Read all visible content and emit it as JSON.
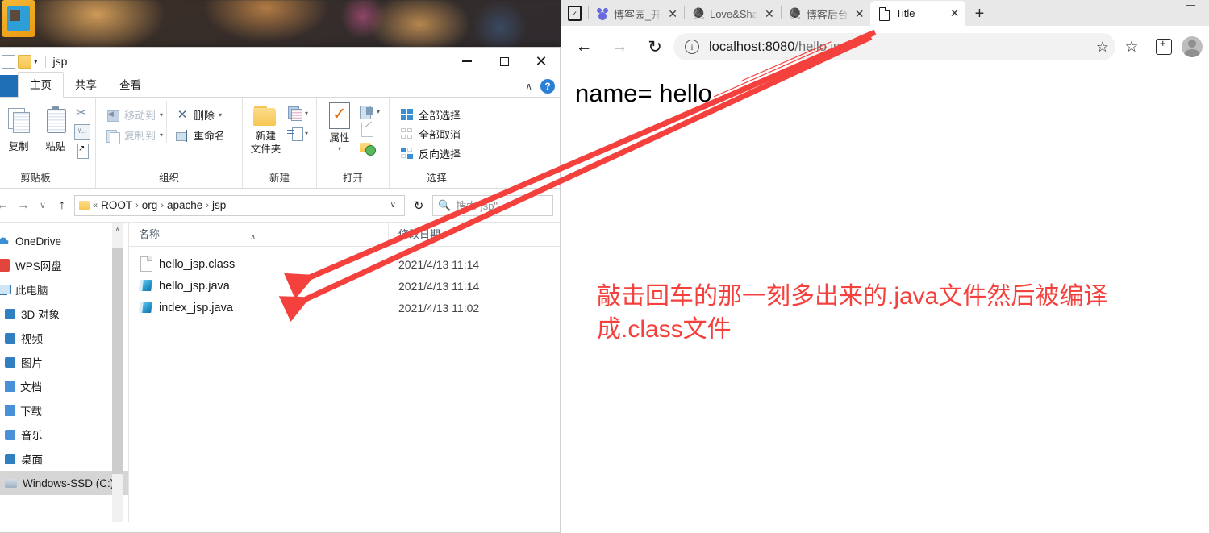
{
  "desktop": {
    "icon_name": "desktop-folder-icon"
  },
  "explorer": {
    "title": "jsp",
    "quick_access": {
      "properties_icon": "properties-icon",
      "new_folder_icon": "new-folder-icon",
      "customize_caret": "▾"
    },
    "window_controls": {
      "minimize": "minimize-button",
      "maximize": "maximize-button",
      "close": "✕"
    },
    "ribbon_tabs": [
      {
        "label": "主页",
        "active": true
      },
      {
        "label": "共享",
        "active": false
      },
      {
        "label": "查看",
        "active": false
      }
    ],
    "ribbon_collapse_caret": "∧",
    "help_label": "?",
    "groups": [
      {
        "title": "剪贴板",
        "big_buttons": [
          {
            "label": "复制",
            "icon": "copy-icon"
          },
          {
            "label": "粘贴",
            "icon": "paste-icon"
          }
        ],
        "small_buttons": [
          {
            "label": "剪切",
            "icon": "cut-icon"
          },
          {
            "label": "复制路径",
            "icon": "copy-path-icon"
          },
          {
            "label": "粘贴快捷方式",
            "icon": "paste-shortcut-icon"
          }
        ]
      },
      {
        "title": "组织",
        "items": [
          {
            "label": "移动到",
            "icon": "move-to-icon",
            "caret": "▾",
            "disabled": true
          },
          {
            "label": "复制到",
            "icon": "copy-to-icon",
            "caret": "▾",
            "disabled": true
          },
          {
            "label": "删除",
            "icon": "delete-icon",
            "caret": "▾",
            "disabled": false
          },
          {
            "label": "重命名",
            "icon": "rename-icon",
            "caret": "",
            "disabled": false
          }
        ]
      },
      {
        "title": "新建",
        "new_folder_label_line1": "新建",
        "new_folder_label_line2": "文件夹",
        "items": [
          {
            "icon": "new-item-icon",
            "caret": "▾"
          },
          {
            "icon": "easy-access-icon",
            "caret": "▾"
          }
        ]
      },
      {
        "title": "打开",
        "properties_label": "属性",
        "properties_caret": "▾",
        "items": [
          {
            "icon": "open-with-icon"
          },
          {
            "icon": "edit-icon"
          },
          {
            "icon": "history-icon"
          }
        ]
      },
      {
        "title": "选择",
        "items": [
          {
            "label": "全部选择",
            "icon": "select-all-icon"
          },
          {
            "label": "全部取消",
            "icon": "select-none-icon"
          },
          {
            "label": "反向选择",
            "icon": "invert-selection-icon"
          }
        ]
      }
    ],
    "navigation": {
      "back": "←",
      "forward": "→",
      "recent_caret": "∨",
      "up": "↑",
      "breadcrumb_prefix": "«",
      "breadcrumb": [
        "ROOT",
        "org",
        "apache",
        "jsp"
      ],
      "breadcrumb_sep": "›",
      "address_dropdown": "∨",
      "refresh": "↻",
      "search_icon": "search-icon",
      "search_placeholder": "搜索\"jsp\""
    },
    "nav_pane": {
      "items": [
        {
          "label": "OneDrive",
          "icon": "onedrive-icon",
          "selected": false
        },
        {
          "label": "WPS网盘",
          "icon": "wps-cloud-icon",
          "selected": false
        },
        {
          "label": "此电脑",
          "icon": "this-pc-icon",
          "selected": false
        },
        {
          "label": "3D 对象",
          "icon": "3d-objects-icon",
          "selected": false
        },
        {
          "label": "视频",
          "icon": "videos-icon",
          "selected": false
        },
        {
          "label": "图片",
          "icon": "pictures-icon",
          "selected": false
        },
        {
          "label": "文档",
          "icon": "documents-icon",
          "selected": false
        },
        {
          "label": "下载",
          "icon": "downloads-icon",
          "selected": false
        },
        {
          "label": "音乐",
          "icon": "music-icon",
          "selected": false
        },
        {
          "label": "桌面",
          "icon": "desktop-icon",
          "selected": false
        },
        {
          "label": "Windows-SSD (C:)",
          "icon": "drive-icon",
          "selected": true
        }
      ],
      "scroll_up_caret": "∧"
    },
    "file_list": {
      "columns": [
        {
          "label": "名称",
          "sort_caret": "∧"
        },
        {
          "label": "修改日期",
          "sort_caret": ""
        }
      ],
      "rows": [
        {
          "name": "hello_jsp.class",
          "icon": "generic-file-icon",
          "date": "2021/4/13 11:14"
        },
        {
          "name": "hello_jsp.java",
          "icon": "java-file-icon",
          "date": "2021/4/13 11:14"
        },
        {
          "name": "index_jsp.java",
          "icon": "java-file-icon",
          "date": "2021/4/13 11:02"
        }
      ]
    }
  },
  "browser": {
    "collections_icon": "collections-icon",
    "tabs": [
      {
        "title": "博客园_开",
        "favicon": "baidu-favicon",
        "active": false,
        "close": "✕"
      },
      {
        "title": "Love&Sha",
        "favicon": "cnblogs-favicon",
        "active": false,
        "close": "✕"
      },
      {
        "title": "博客后台",
        "favicon": "cnblogs-favicon",
        "active": false,
        "close": "✕"
      },
      {
        "title": "Title",
        "favicon": "page-favicon",
        "active": true,
        "close": "✕"
      }
    ],
    "new_tab_label": "+",
    "toolbar": {
      "back": "←",
      "forward": "→",
      "reload": "↻",
      "info_icon": "ⓘ",
      "url_host": "localhost:8080",
      "url_path": "/hello.jsp",
      "favorite_icon": "add-favorite-icon",
      "favorites_bar_icon": "favorites-icon",
      "collections_icon": "collections-add-icon",
      "profile_icon": "profile-avatar"
    },
    "page": {
      "content": "name= hello",
      "annotation_line1": "敲击回车的那一刻多出来的.java文件然后被编译",
      "annotation_line2": "成.class文件",
      "annotation_color": "#f4413d"
    }
  }
}
